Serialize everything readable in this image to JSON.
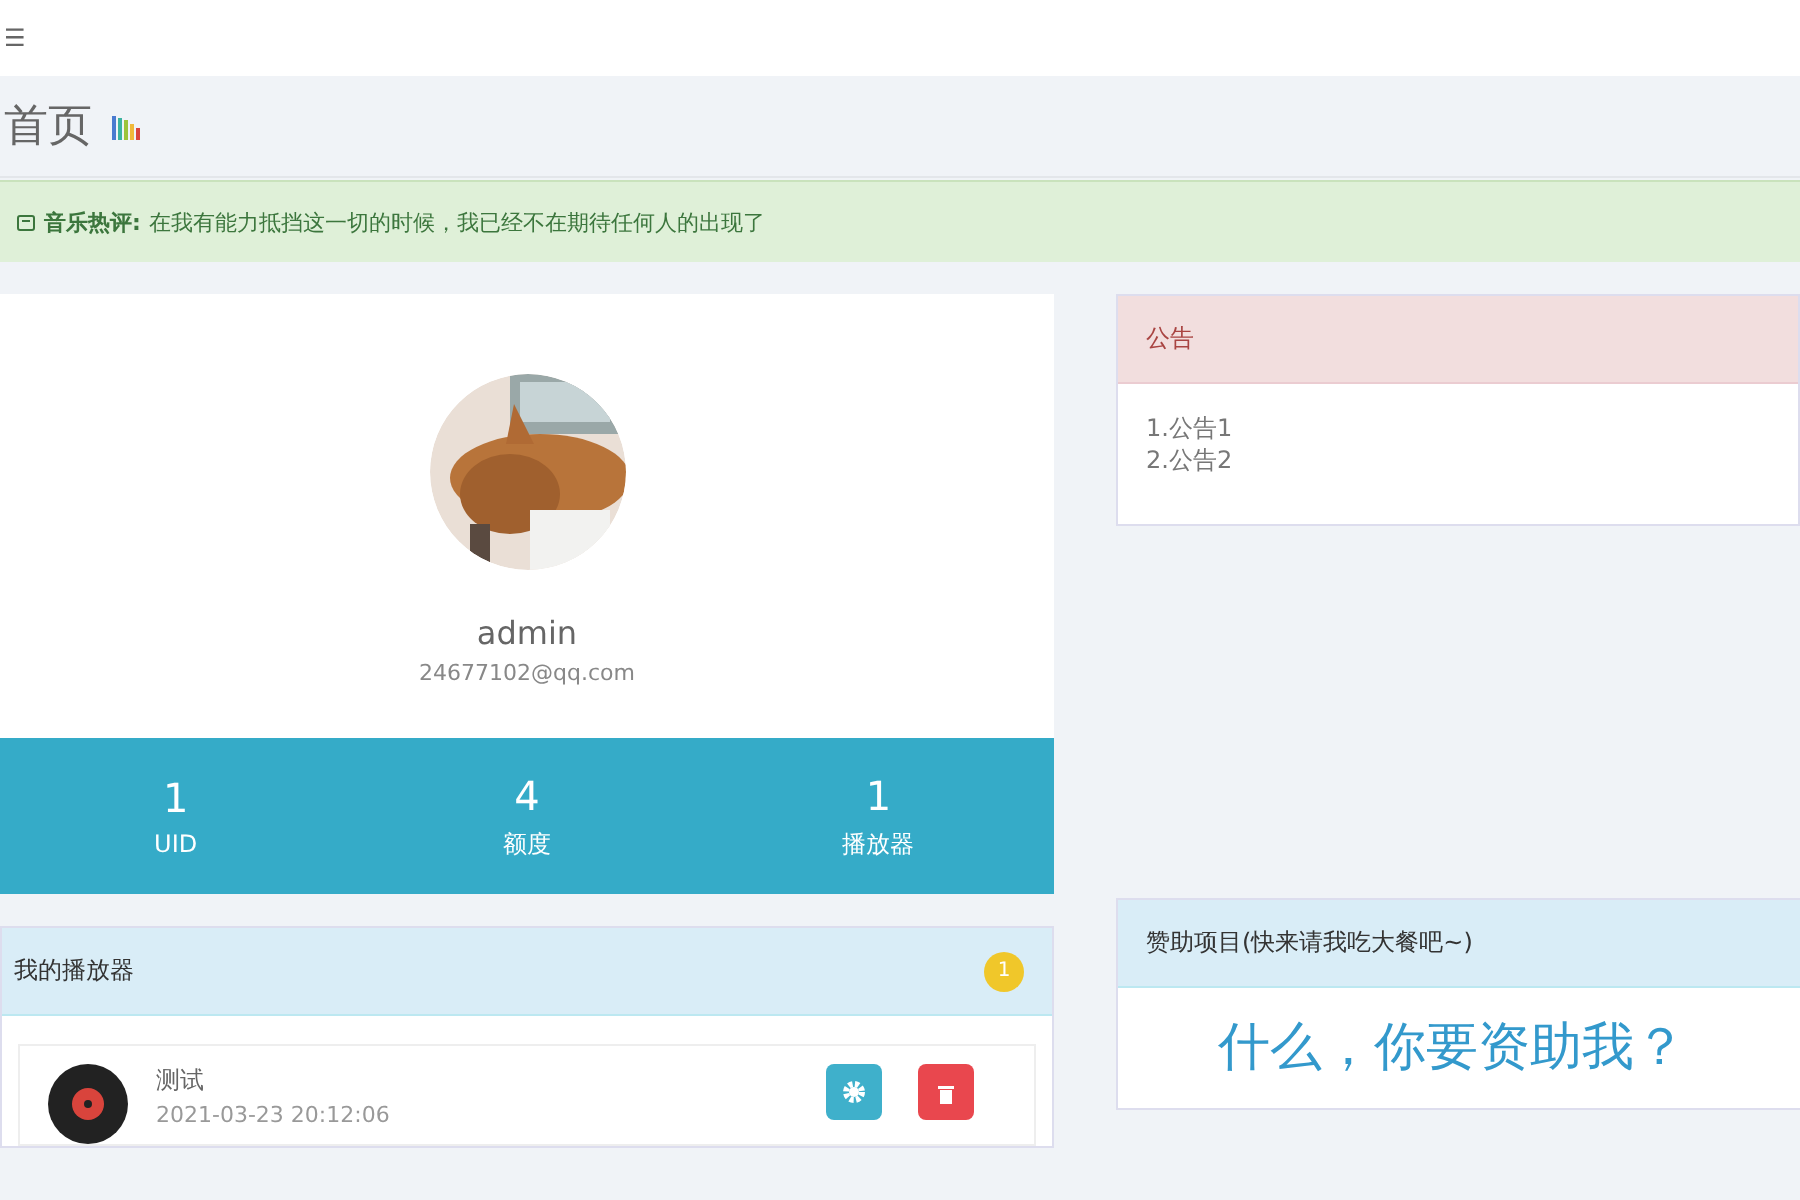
{
  "topbar": {
    "menu": "☰"
  },
  "page": {
    "title": "首页"
  },
  "alert": {
    "label": "音乐热评:",
    "text": "在我有能力抵挡这一切的时候，我已经不在期待任何人的出现了"
  },
  "profile": {
    "name": "admin",
    "email": "24677102@qq.com",
    "stats": [
      {
        "value": "1",
        "label": "UID"
      },
      {
        "value": "4",
        "label": "额度"
      },
      {
        "value": "1",
        "label": "播放器"
      }
    ]
  },
  "notice": {
    "title": "公告",
    "lines": [
      "1.公告1",
      "2.公告2"
    ]
  },
  "players": {
    "title": "我的播放器",
    "badge": "1",
    "items": [
      {
        "name": "测试",
        "date": "2021-03-23 20:12:06"
      }
    ]
  },
  "sponsor": {
    "title": "赞助项目(快来请我吃大餐吧~)",
    "headline": "什么，你要资助我？"
  }
}
